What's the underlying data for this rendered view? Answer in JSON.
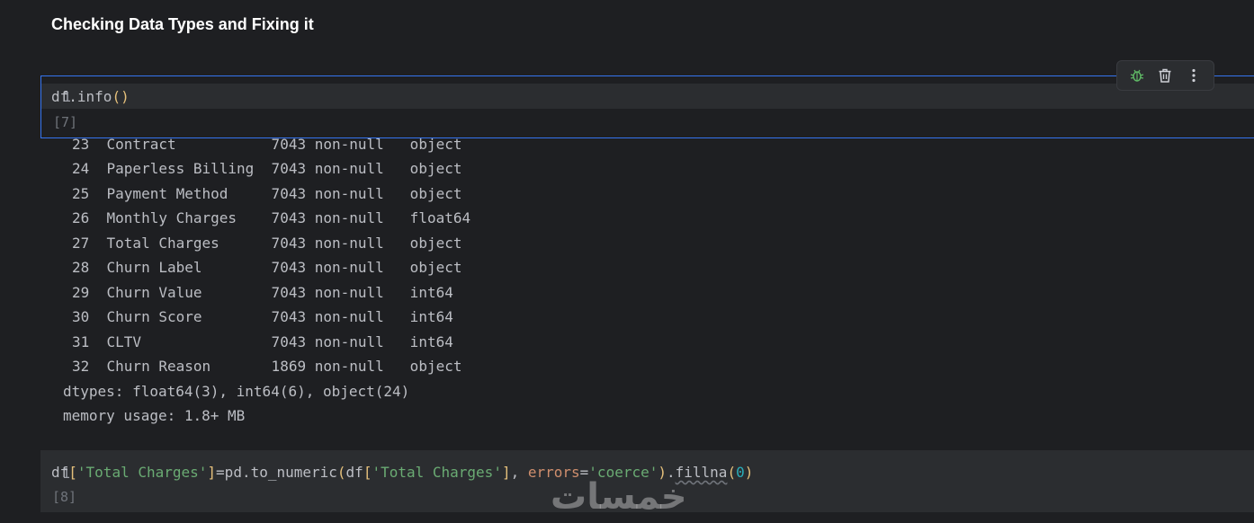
{
  "markdown": {
    "heading": "Checking Data Types and Fixing it"
  },
  "cell1": {
    "line_number": "1",
    "code_parts": [
      "df.info",
      "()"
    ],
    "exec_count": "[7]"
  },
  "toolbar": {
    "items": [
      {
        "icon": "bug-icon",
        "label": "Debug cell"
      },
      {
        "icon": "trash-icon",
        "label": "Delete cell"
      },
      {
        "icon": "more-vertical-icon",
        "label": "More actions"
      }
    ]
  },
  "output": {
    "rows": [
      "23  Contract           7043 non-null   object",
      "24  Paperless Billing  7043 non-null   object",
      "25  Payment Method     7043 non-null   object",
      "26  Monthly Charges    7043 non-null   float64",
      "27  Total Charges      7043 non-null   object",
      "28  Churn Label        7043 non-null   object",
      "29  Churn Value        7043 non-null   int64",
      "30  Churn Score        7043 non-null   int64",
      "31  CLTV               7043 non-null   int64",
      "32  Churn Reason       1869 non-null   object"
    ],
    "dtypes": "dtypes: float64(3), int64(6), object(24)",
    "memory": "memory usage: 1.8+ MB"
  },
  "cell2": {
    "line_number": "1",
    "code_parts": {
      "p1": "df",
      "p2": "[",
      "p3": "'Total Charges'",
      "p4": "]",
      "p5": "=pd.to_numeric",
      "p6": "(",
      "p7": "df",
      "p8": "[",
      "p9": "'Total Charges'",
      "p10": "]",
      "p11": ", ",
      "p12": "errors",
      "p13": "=",
      "p14": "'coerce'",
      "p15": ")",
      "p16": ".",
      "p17": "fillna",
      "p18": "(",
      "p19": "0",
      "p20": ")"
    },
    "exec_count": "[8]"
  },
  "watermark": "خمسات",
  "colors": {
    "background": "#1e1f22",
    "cell": "#2b2d30",
    "selection_border": "#3574f0",
    "string": "#6aab73",
    "keyword_arg": "#cf8e6d",
    "number": "#2aacb8",
    "paren": "#e5c07b"
  }
}
